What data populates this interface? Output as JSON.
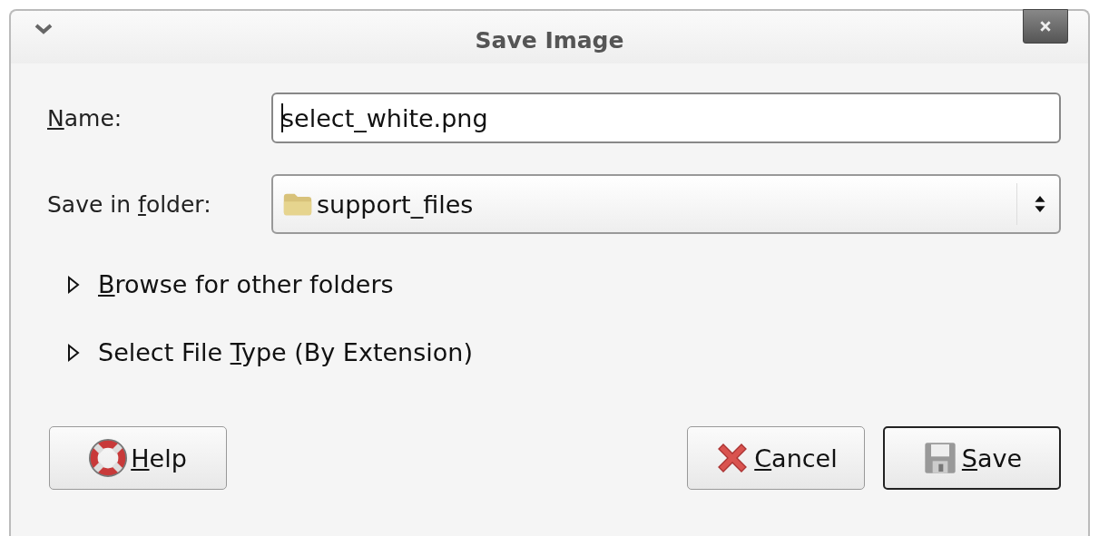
{
  "window": {
    "title": "Save Image"
  },
  "name_field": {
    "label": {
      "key": "N",
      "post": "ame:"
    },
    "value": "select_white.png",
    "focused": true
  },
  "folder_field": {
    "label": {
      "pre": "Save in ",
      "key": "f",
      "post": "older:"
    },
    "value": "support_files"
  },
  "expanders": [
    {
      "label": {
        "key": "B",
        "post": "rowse for other folders"
      },
      "expanded": false
    },
    {
      "label": {
        "pre": "Select File ",
        "key": "T",
        "post": "ype (By Extension)"
      },
      "expanded": false
    }
  ],
  "buttons": [
    {
      "kind": "help",
      "label": {
        "key": "H",
        "post": "elp"
      },
      "default": false
    },
    {
      "kind": "cancel",
      "label": {
        "key": "C",
        "post": "ancel"
      },
      "default": false
    },
    {
      "kind": "save",
      "label": {
        "key": "S",
        "post": "ave"
      },
      "default": true
    }
  ]
}
